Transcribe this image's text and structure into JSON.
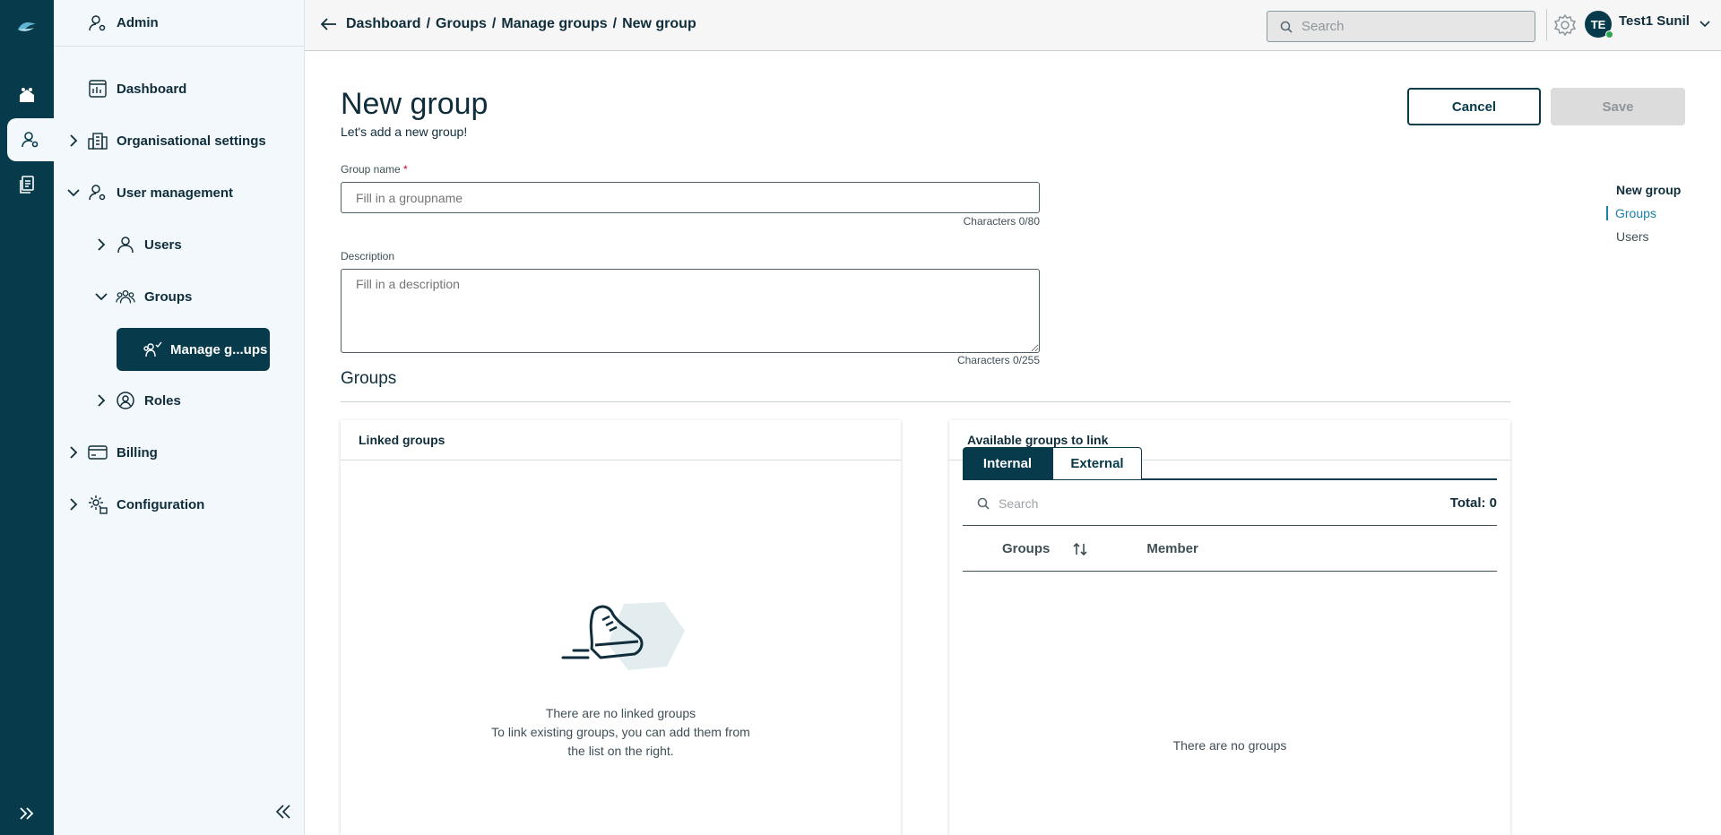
{
  "rail": {
    "items": [
      {
        "icon": "logo-icon"
      },
      {
        "icon": "home-icon"
      },
      {
        "icon": "user-admin-icon"
      },
      {
        "icon": "documents-icon"
      },
      {
        "icon": "expand-rail-icon"
      }
    ]
  },
  "sidebar": {
    "header": "Admin",
    "items": {
      "dashboard": "Dashboard",
      "org_settings": "Organisational settings",
      "user_management": "User management",
      "users": "Users",
      "groups": "Groups",
      "manage_groups": "Manage g...ups",
      "roles": "Roles",
      "billing": "Billing",
      "configuration": "Configuration"
    }
  },
  "topbar": {
    "breadcrumb": [
      "Dashboard",
      "Groups",
      "Manage groups",
      "New group"
    ],
    "search_placeholder": "Search",
    "user_initials": "TE",
    "user_name": "Test1 Sunil"
  },
  "page": {
    "title": "New group",
    "subtitle": "Let's add a new group!",
    "cancel_label": "Cancel",
    "save_label": "Save",
    "group_name_label": "Group name",
    "required_mark": "*",
    "group_name_placeholder": "Fill in a groupname",
    "group_name_counter": "Characters 0/80",
    "description_label": "Description",
    "description_placeholder": "Fill in a description",
    "description_counter": "Characters 0/255",
    "groups_section_title": "Groups"
  },
  "toc": {
    "items": [
      "New group",
      "Groups",
      "Users"
    ],
    "active_index": 1
  },
  "linked_groups": {
    "title": "Linked groups",
    "empty_title": "There are no linked groups",
    "empty_text_1": "To link existing groups, you can add them from",
    "empty_text_2": "the list on the right."
  },
  "available_groups": {
    "title": "Available groups to link",
    "tabs": [
      "Internal",
      "External"
    ],
    "active_tab": "Internal",
    "search_placeholder": "Search",
    "total": "Total: 0",
    "columns": [
      "Groups",
      "Member"
    ],
    "empty_text": "There are no groups"
  },
  "colors": {
    "brand_dark": "#073b4c",
    "accent_teal": "#1b7fa3",
    "status_online": "#2ea44f"
  }
}
